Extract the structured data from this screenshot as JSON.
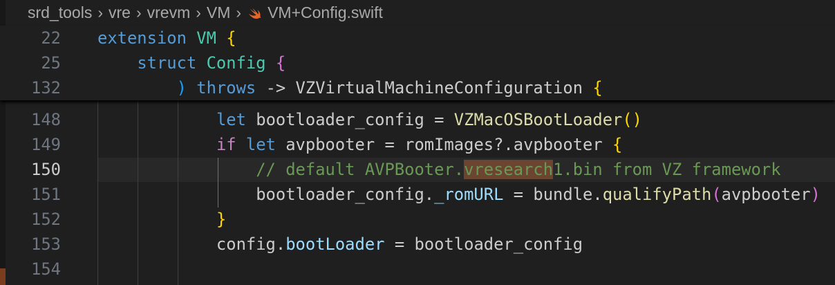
{
  "breadcrumb": [
    "srd_tools",
    "vre",
    "vrevm",
    "VM",
    "VM+Config.swift"
  ],
  "sticky": [
    {
      "n": "22",
      "tokens": [
        [
          "k",
          "extension "
        ],
        [
          "t",
          "VM"
        ],
        [
          "",
          ""
        ],
        [
          "y",
          " {"
        ]
      ]
    },
    {
      "n": "25",
      "tokens": [
        [
          "",
          "    "
        ],
        [
          "k",
          "struct "
        ],
        [
          "t",
          "Config"
        ],
        [
          "p",
          " {"
        ]
      ]
    },
    {
      "n": "132",
      "tokens": [
        [
          "",
          "        "
        ],
        [
          "b",
          ")"
        ],
        [
          "k",
          " throws"
        ],
        [
          "",
          " -> VZVirtualMachineConfiguration "
        ],
        [
          "y",
          "{"
        ]
      ]
    }
  ],
  "lines": [
    {
      "n": "148",
      "tokens": [
        [
          "",
          "            "
        ],
        [
          "k",
          "let"
        ],
        [
          "",
          " bootloader_config = "
        ],
        [
          "f",
          "VZMacOSBootLoader"
        ],
        [
          "y",
          "()"
        ]
      ]
    },
    {
      "n": "149",
      "tokens": [
        [
          "",
          "            "
        ],
        [
          "c",
          "if "
        ],
        [
          "k",
          "let"
        ],
        [
          "",
          " avpbooter = romImages?.avpbooter "
        ],
        [
          "y",
          "{"
        ]
      ]
    },
    {
      "n": "150",
      "current": true,
      "tokens": [
        [
          "",
          "                "
        ],
        [
          "cm",
          "// default AVPBooter."
        ],
        [
          "cm match",
          "vresearch"
        ],
        [
          "cm",
          "1.bin from VZ framework"
        ]
      ]
    },
    {
      "n": "151",
      "tokens": [
        [
          "",
          "                bootloader_config."
        ],
        [
          "v",
          "_romURL"
        ],
        [
          "",
          " = bundle."
        ],
        [
          "f",
          "qualifyPath"
        ],
        [
          "p",
          "("
        ],
        [
          "",
          "avpbooter"
        ],
        [
          "p",
          ")"
        ]
      ]
    },
    {
      "n": "152",
      "tokens": [
        [
          "",
          "            "
        ],
        [
          "y",
          "}"
        ]
      ]
    },
    {
      "n": "153",
      "tokens": [
        [
          "",
          "            config."
        ],
        [
          "v",
          "bootLoader"
        ],
        [
          "",
          " = bootloader_config"
        ]
      ]
    },
    {
      "n": "154",
      "tokens": []
    }
  ],
  "colors": {
    "background": "#1f1f1f",
    "keyword": "#569cd6",
    "type": "#4ec9b0",
    "comment": "#6a9955",
    "match": "#6b4530"
  }
}
